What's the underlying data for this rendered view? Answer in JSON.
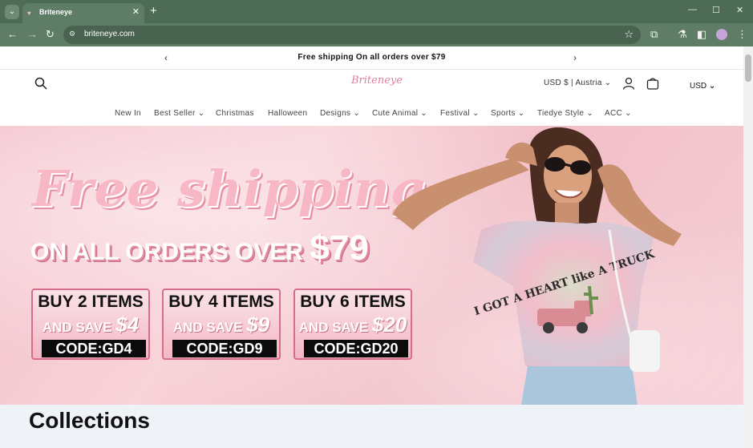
{
  "browser": {
    "tab_title": "Briteneye",
    "url": "briteneye.com",
    "accent_color": "#4e6b55"
  },
  "announcement": {
    "text": "Free shipping On all orders over $79"
  },
  "header": {
    "logo_text": "Briteneye",
    "country_selector": "USD $ | Austria",
    "currency": "USD"
  },
  "nav": {
    "items": [
      {
        "label": "New In",
        "dropdown": false
      },
      {
        "label": "Best Seller",
        "dropdown": true
      },
      {
        "label": "Christmas",
        "dropdown": false
      },
      {
        "label": "Halloween",
        "dropdown": false
      },
      {
        "label": "Designs",
        "dropdown": true
      },
      {
        "label": "Cute Animal",
        "dropdown": true
      },
      {
        "label": "Festival",
        "dropdown": true
      },
      {
        "label": "Sports",
        "dropdown": true
      },
      {
        "label": "Tiedye Style",
        "dropdown": true
      },
      {
        "label": "ACC",
        "dropdown": true
      }
    ]
  },
  "hero": {
    "headline": "Free shipping",
    "subheadline_prefix": "ON ALL ORDERS OVER",
    "subheadline_amount": "$79",
    "shirt_text": "I GOT A HEART like A TRUCK",
    "promos": [
      {
        "buy": "BUY 2 ITEMS",
        "save_prefix": "AND SAVE",
        "save_amount": "$4",
        "code": "CODE:GD4"
      },
      {
        "buy": "BUY 4 ITEMS",
        "save_prefix": "AND SAVE",
        "save_amount": "$9",
        "code": "CODE:GD9"
      },
      {
        "buy": "BUY 6 ITEMS",
        "save_prefix": "AND SAVE",
        "save_amount": "$20",
        "code": "CODE:GD20"
      }
    ]
  },
  "collections": {
    "heading": "Collections"
  }
}
